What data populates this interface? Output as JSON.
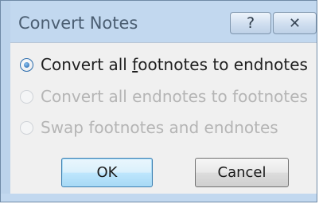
{
  "dialog": {
    "title": "Convert Notes",
    "help_glyph": "?",
    "close_glyph": "✕"
  },
  "options": [
    {
      "label_pre": "Convert all ",
      "label_accel": "f",
      "label_post": "ootnotes to endnotes",
      "checked": true,
      "enabled": true
    },
    {
      "label": "Convert all endnotes to footnotes",
      "checked": false,
      "enabled": false
    },
    {
      "label": "Swap footnotes and endnotes",
      "checked": false,
      "enabled": false
    }
  ],
  "buttons": {
    "ok_label": "OK",
    "cancel_label": "Cancel"
  },
  "colors": {
    "frame": "#c2d8ef",
    "client": "#f0f0f0",
    "disabled_text": "#b5b5b5",
    "default_button_border": "#3c7fb1"
  }
}
